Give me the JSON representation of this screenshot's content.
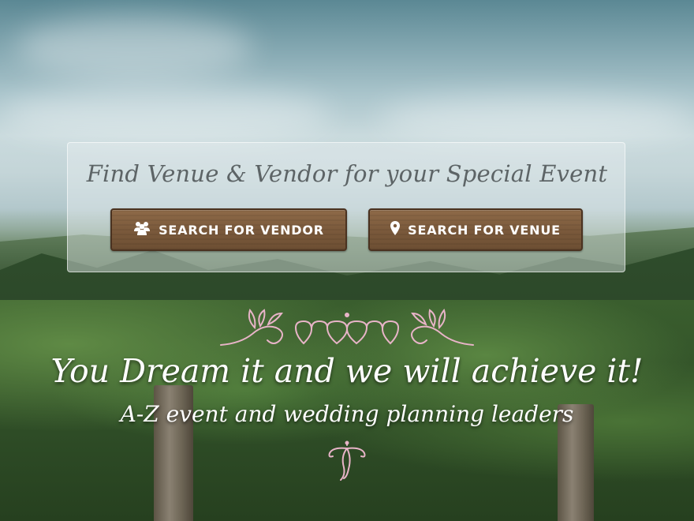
{
  "search": {
    "title": "Find Venue & Vendor for your Special Event",
    "vendor_button": "SEARCH FOR VENDOR",
    "venue_button": "SEARCH FOR VENUE"
  },
  "hero": {
    "tagline": "You Dream it and we will achieve it!",
    "subline": "A-Z event and wedding planning leaders"
  },
  "icons": {
    "vendor": "group-icon",
    "venue": "map-pin-icon",
    "ornament": "hearts-ornament",
    "flourish": "flourish-ornament"
  },
  "colors": {
    "wood": "#7b5a3c",
    "ornament_pink": "#e8b4c8",
    "text_white": "#ffffff"
  }
}
